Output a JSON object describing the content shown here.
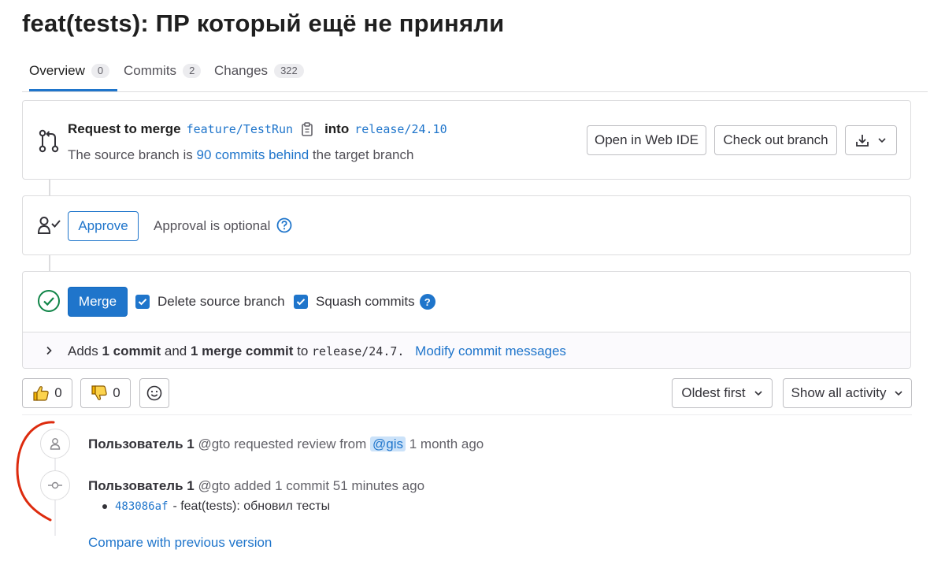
{
  "page_title": "feat(tests): ПР который ещё не приняли",
  "tabs": [
    {
      "label": "Overview",
      "count": "0"
    },
    {
      "label": "Commits",
      "count": "2"
    },
    {
      "label": "Changes",
      "count": "322"
    }
  ],
  "merge_request": {
    "prefix": "Request to merge",
    "source_branch": "feature/TestRun",
    "into": "into",
    "target_branch": "release/24.10",
    "behind_prefix": "The source branch is",
    "behind_link": "90 commits behind",
    "behind_suffix": "the target branch",
    "open_ide_label": "Open in Web IDE",
    "checkout_label": "Check out branch"
  },
  "approval": {
    "approve_label": "Approve",
    "optional_text": "Approval is optional"
  },
  "merge": {
    "merge_label": "Merge",
    "delete_branch_label": "Delete source branch",
    "squash_label": "Squash commits",
    "adds_prefix": "Adds",
    "adds_commit": "1 commit",
    "adds_and": "and",
    "adds_merge_commit": "1 merge commit",
    "adds_to": "to",
    "adds_branch": "release/24.7.",
    "modify_link": "Modify commit messages"
  },
  "reactions": {
    "thumbs_up_count": "0",
    "thumbs_down_count": "0"
  },
  "filters": {
    "sort_label": "Oldest first",
    "activity_label": "Show all activity"
  },
  "timeline": {
    "item1": {
      "author": "Пользователь 1",
      "handle": "@gto",
      "action": "requested review from",
      "mention": "@gis",
      "time": "1 month ago"
    },
    "item2": {
      "author": "Пользователь 1",
      "handle": "@gto",
      "action": "added 1 commit",
      "time": "51 minutes ago"
    },
    "commit_sha": "483086af",
    "commit_message": "- feat(tests): обновил тесты",
    "compare_link": "Compare with previous version"
  },
  "colors": {
    "accent": "#1f75cb",
    "success": "#108548",
    "annotation": "#dd2b0e"
  }
}
